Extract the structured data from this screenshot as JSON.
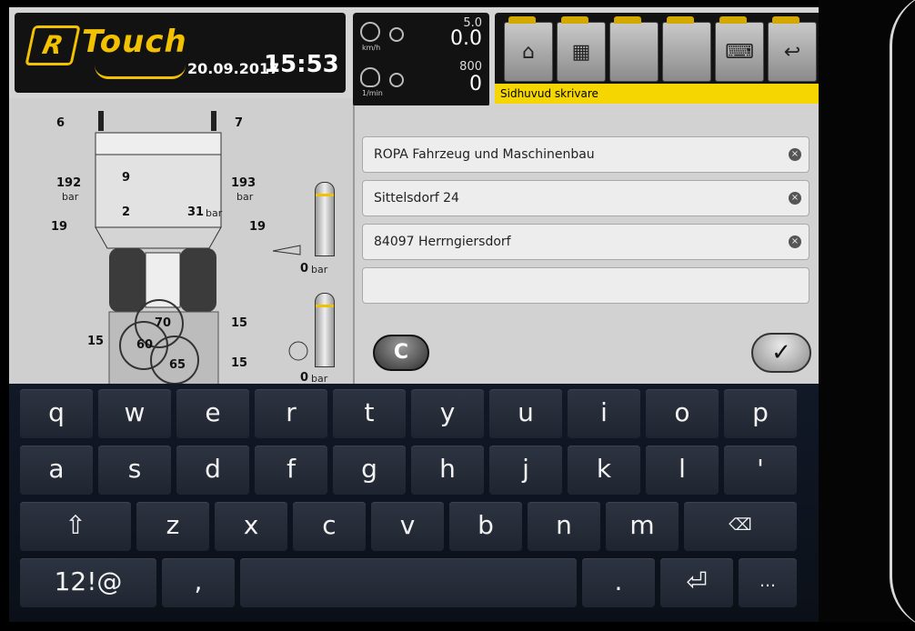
{
  "header": {
    "logo_mark": "R",
    "logo_text": "Touch",
    "date": "20.09.2017",
    "time": "15:53"
  },
  "gauges": {
    "speed_unit": "km/h",
    "speed_max": "5.0",
    "speed_value": "0.0",
    "rpm_unit": "1/min",
    "rpm_max": "800",
    "rpm_value": "0"
  },
  "toolbar": {
    "home_icon": "home-icon",
    "menu_icon": "machine-menu-icon",
    "keyboard_icon": "keyboard-icon",
    "back_icon": "back-icon",
    "status_text": "Sidhuvud skrivare"
  },
  "diagram": {
    "top_left_label": "6",
    "top_right_label": "7",
    "left_pressure": "192",
    "left_pressure_unit": "bar",
    "right_pressure": "193",
    "right_pressure_unit": "bar",
    "label_9": "9",
    "label_2": "2",
    "label_31": "31",
    "label_31_unit": "bar",
    "left_19": "19",
    "right_19": "19",
    "tank1_value": "0",
    "tank1_unit": "bar",
    "tank2_value": "0",
    "tank2_unit": "bar",
    "circle_70": "70",
    "circle_60": "60",
    "circle_65": "65",
    "left_15": "15",
    "right_15_a": "15",
    "right_15_b": "15"
  },
  "form": {
    "fields": [
      {
        "value": "ROPA Fahrzeug und Maschinenbau"
      },
      {
        "value": "Sittelsdorf 24"
      },
      {
        "value": "84097 Herrngiersdorf"
      },
      {
        "value": ""
      }
    ],
    "clear_label": "C",
    "confirm_label": "✓"
  },
  "keyboard": {
    "row1": [
      "q",
      "w",
      "e",
      "r",
      "t",
      "y",
      "u",
      "i",
      "o",
      "p"
    ],
    "row2": [
      "a",
      "s",
      "d",
      "f",
      "g",
      "h",
      "j",
      "k",
      "l",
      "'"
    ],
    "row3": [
      "⇧",
      "z",
      "x",
      "c",
      "v",
      "b",
      "n",
      "m",
      "⌫"
    ],
    "row4": [
      "12!@",
      ",",
      "",
      ".",
      "⏎",
      "…"
    ]
  }
}
